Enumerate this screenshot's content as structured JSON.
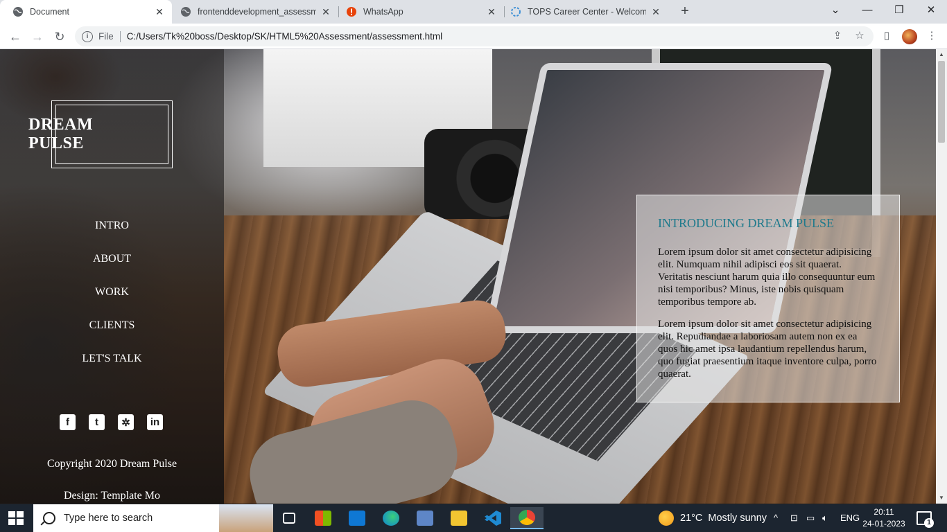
{
  "browser": {
    "tabs": [
      {
        "title": "Document",
        "close": "✕"
      },
      {
        "title": "frontenddevelopment_assessmen",
        "close": "✕"
      },
      {
        "title": "WhatsApp",
        "close": "✕"
      },
      {
        "title": "TOPS Career Center - Welcome t",
        "close": "✕"
      }
    ],
    "new_tab": "+",
    "address": {
      "scheme_label": "File",
      "url": "C:/Users/Tk%20boss/Desktop/SK/HTML5%20Assessment/assessment.html"
    }
  },
  "site": {
    "logo_line1": "DREAM",
    "logo_line2": "PULSE",
    "nav": [
      "INTRO",
      "ABOUT",
      "WORK",
      "CLIENTS",
      "LET'S TALK"
    ],
    "socials": [
      {
        "icon": "facebook-icon",
        "glyph": "f"
      },
      {
        "icon": "twitter-icon",
        "glyph": "t"
      },
      {
        "icon": "gear-icon",
        "glyph": "✲"
      },
      {
        "icon": "linkedin-icon",
        "glyph": "in"
      }
    ],
    "copyright": "Copyright 2020 Dream Pulse",
    "design": "Design: Template Mo",
    "card": {
      "heading": "INTRODUCING DREAM PULSE",
      "para1": "Lorem ipsum dolor sit amet consectetur adipisicing elit. Numquam nihil adipisci eos sit quaerat. Veritatis nesciunt harum quia illo consequuntur eum nisi temporibus? Minus, iste nobis quisquam temporibus tempore ab.",
      "para2": "Lorem ipsum dolor sit amet consectetur adipisicing elit. Repudiandae a laboriosam autem non ex ea quos hic amet ipsa laudantium repellendus harum, quo fugiat praesentium itaque inventore culpa, porro quaerat."
    },
    "accent_color": "#1f7a8c"
  },
  "taskbar": {
    "search_placeholder": "Type here to search",
    "weather_temp": "21°C",
    "weather_desc": "Mostly sunny",
    "language": "ENG",
    "time": "20:11",
    "date": "24-01-2023",
    "notification_count": "1"
  }
}
